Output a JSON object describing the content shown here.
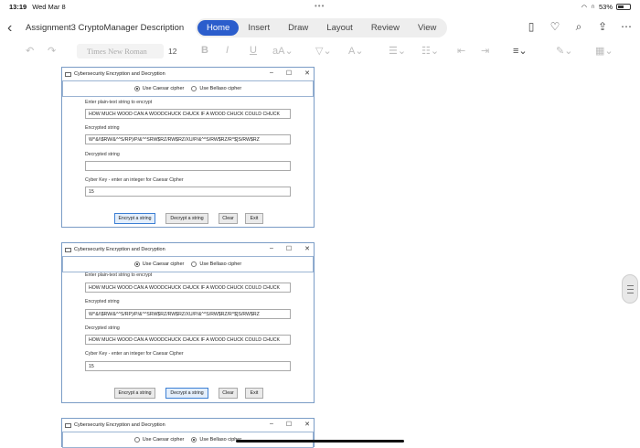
{
  "status": {
    "time": "13:19",
    "date": "Wed Mar 8",
    "battery": "53%",
    "battery_level": 0.53
  },
  "header": {
    "doc_title": "Assignment3 CryptoManager Description",
    "tabs": [
      "Home",
      "Insert",
      "Draw",
      "Layout",
      "Review",
      "View"
    ],
    "active_tab": "Home"
  },
  "toolbar": {
    "font_name": "Times New Roman",
    "font_size": "12"
  },
  "window_title": "Cybersecurity Encryption and Decryption",
  "radio": {
    "caesar": "Use Caesar cipher",
    "bellaso": "Use Bellaso cipher"
  },
  "labels": {
    "plain": "Enter plain-text string to encrypt",
    "encrypted": "Encrypted string",
    "decrypted": "Decrypted string",
    "key": "Cyber Key - enter an integer for Caesar Cipher"
  },
  "buttons": {
    "encrypt": "Encrypt a string",
    "decrypt": "Decrypt a string",
    "clear": "Clear",
    "exit": "Exit"
  },
  "windows": [
    {
      "selected": "caesar",
      "plain_value": "HOW MUCH WOOD CAN A WOODCHUCK CHUCK IF A WOOD CHUCK COULD CHUCK",
      "encrypted_value": "W^&/\\$RW/&^^S/RP)/P/&^^SRW$RZ/RW$RZ/XU/P/&^^S/RW$RZ/R^$]S/RW$RZ",
      "decrypted_value": "",
      "key_value": "15",
      "focused": "encrypt"
    },
    {
      "selected": "caesar",
      "plain_value": "HOW MUCH WOOD CAN A WOODCHUCK CHUCK IF A WOOD CHUCK COULD CHUCK",
      "encrypted_value": "W^&/\\$RW/&^^S/RP)/P/&^^SRW$RZ/RW$RZ/XU/P/&^^S/RW$RZ/R^$]S/RW$RZ",
      "decrypted_value": "HOW MUCH WOOD CAN A WOODCHUCK CHUCK IF A WOOD CHUCK COULD CHUCK",
      "key_value": "15",
      "focused": "decrypt"
    },
    {
      "selected": "bellaso"
    }
  ],
  "window_controls": {
    "minimize": "–",
    "maximize": "☐",
    "close": "✕"
  }
}
